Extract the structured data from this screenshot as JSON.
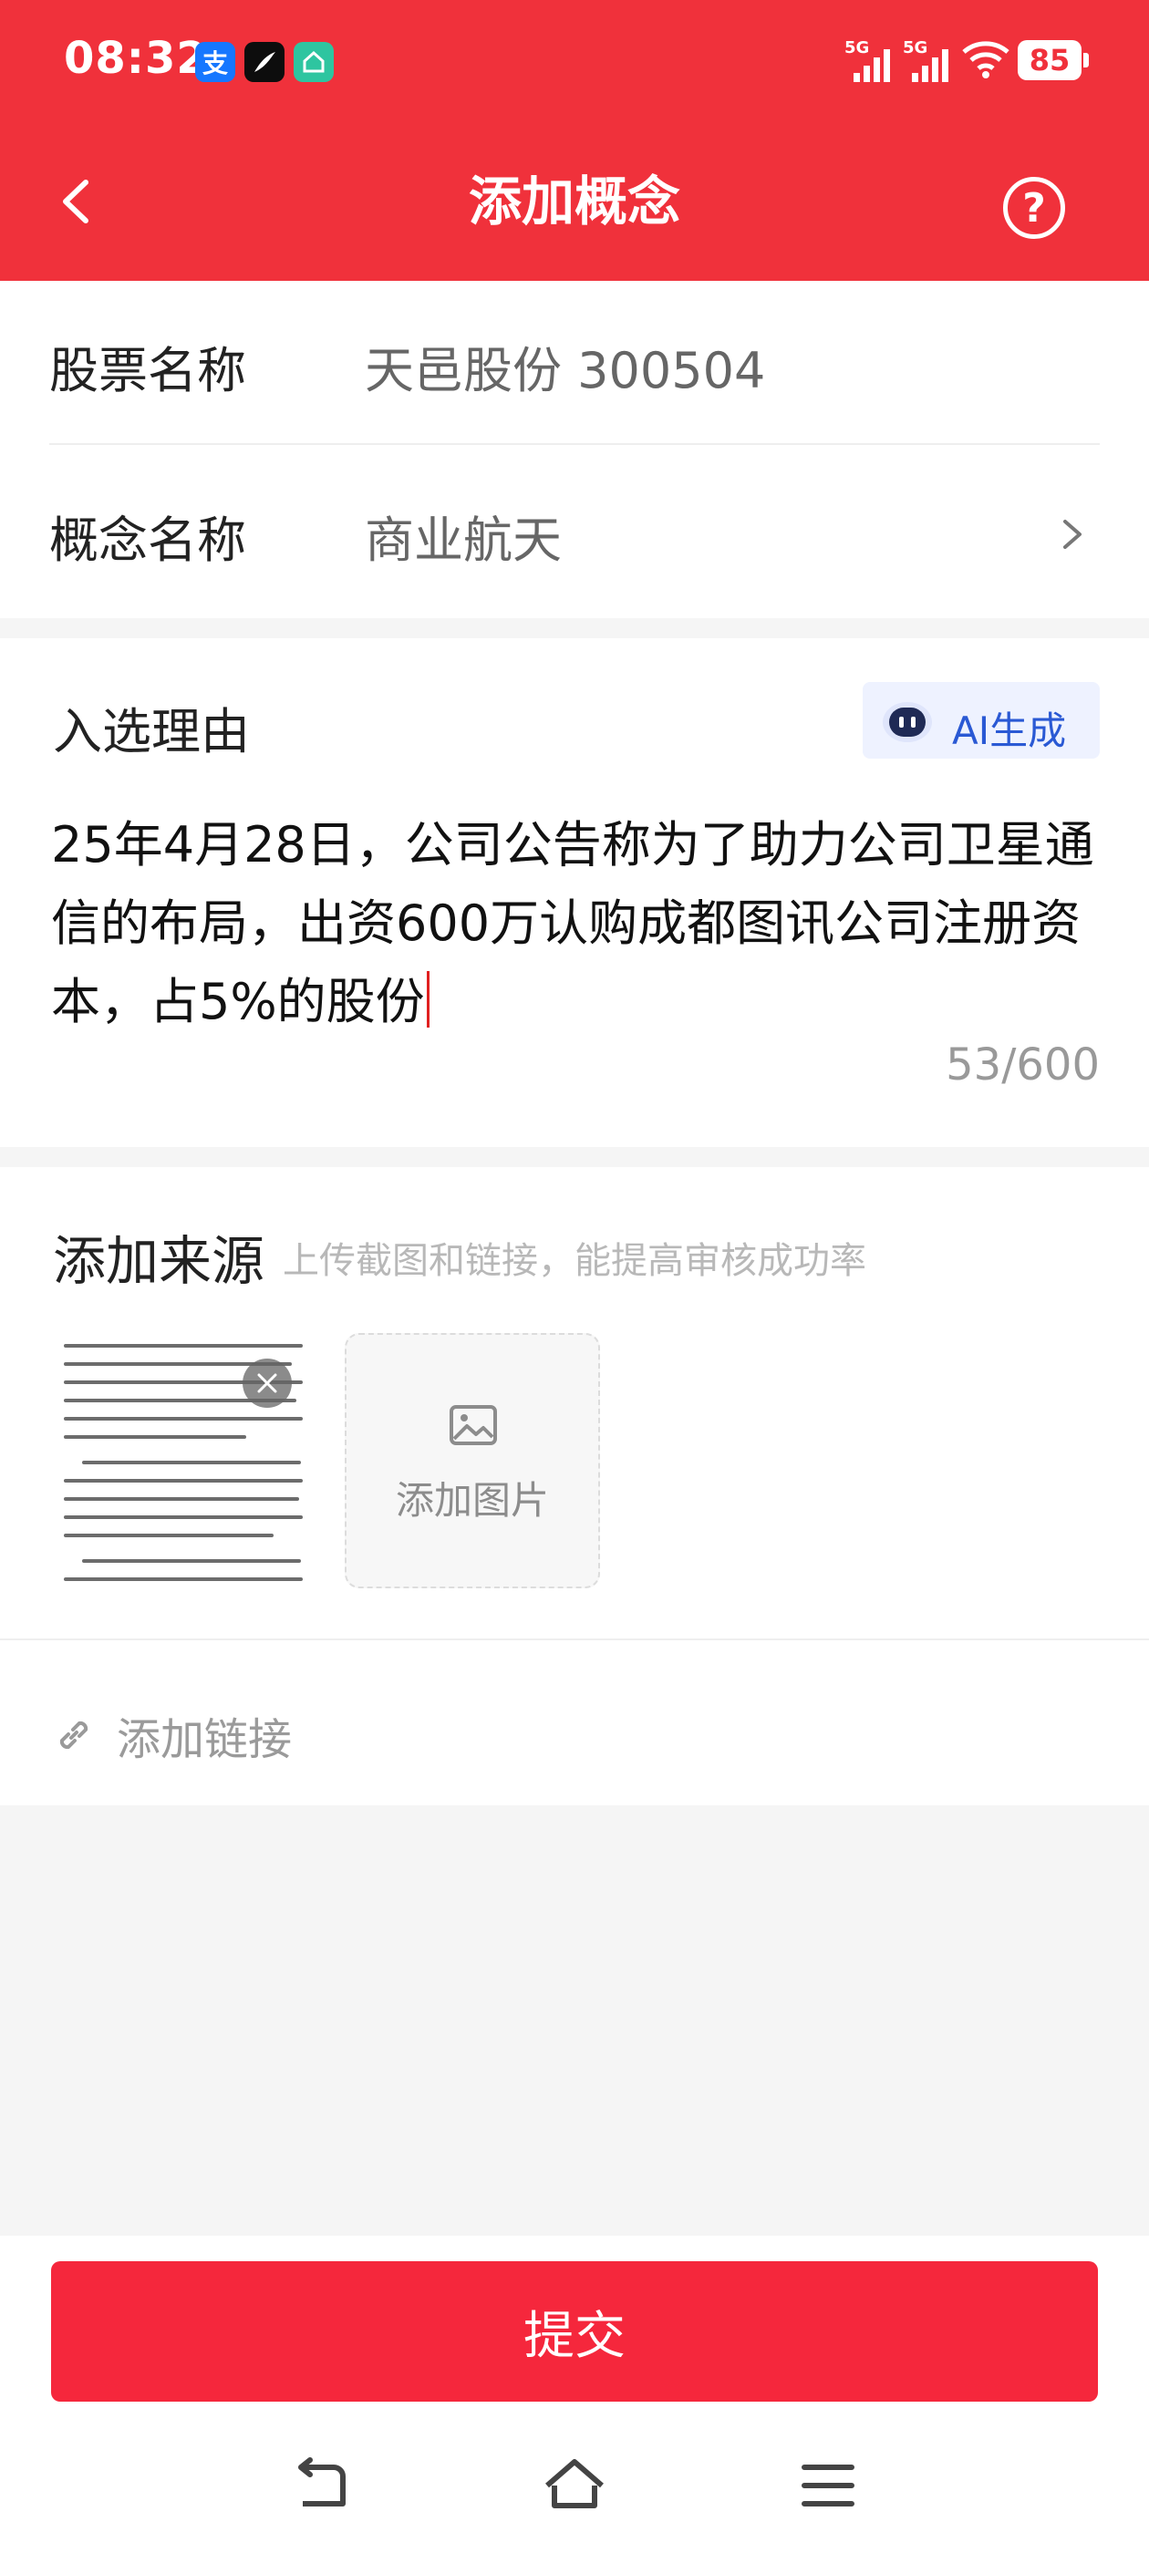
{
  "status_bar": {
    "time": "08:32",
    "signal_1": "5G",
    "signal_2": "5G",
    "battery": "85",
    "app_icons": [
      "alipay-icon",
      "feather-app-icon",
      "home-app-icon"
    ]
  },
  "header": {
    "title": "添加概念",
    "back_icon": "back-arrow-icon",
    "help_icon": "question-circle-icon",
    "background_color": "#f0313b"
  },
  "form": {
    "stock_label": "股票名称",
    "stock_value": "天邑股份 300504",
    "concept_label": "概念名称",
    "concept_value": "商业航天"
  },
  "reason": {
    "label": "入选理由",
    "ai_button": "AI生成",
    "text": "25年4月28日，公司公告称为了助力公司卫星通信的布局，出资600万认购成都图讯公司注册资本，占5%的股份",
    "counter": "53/600"
  },
  "source": {
    "label": "添加来源",
    "hint": "上传截图和链接，能提高审核成功率",
    "add_image": "添加图片",
    "add_link": "添加链接"
  },
  "footer": {
    "submit": "提交",
    "submit_color": "#f5273c"
  }
}
